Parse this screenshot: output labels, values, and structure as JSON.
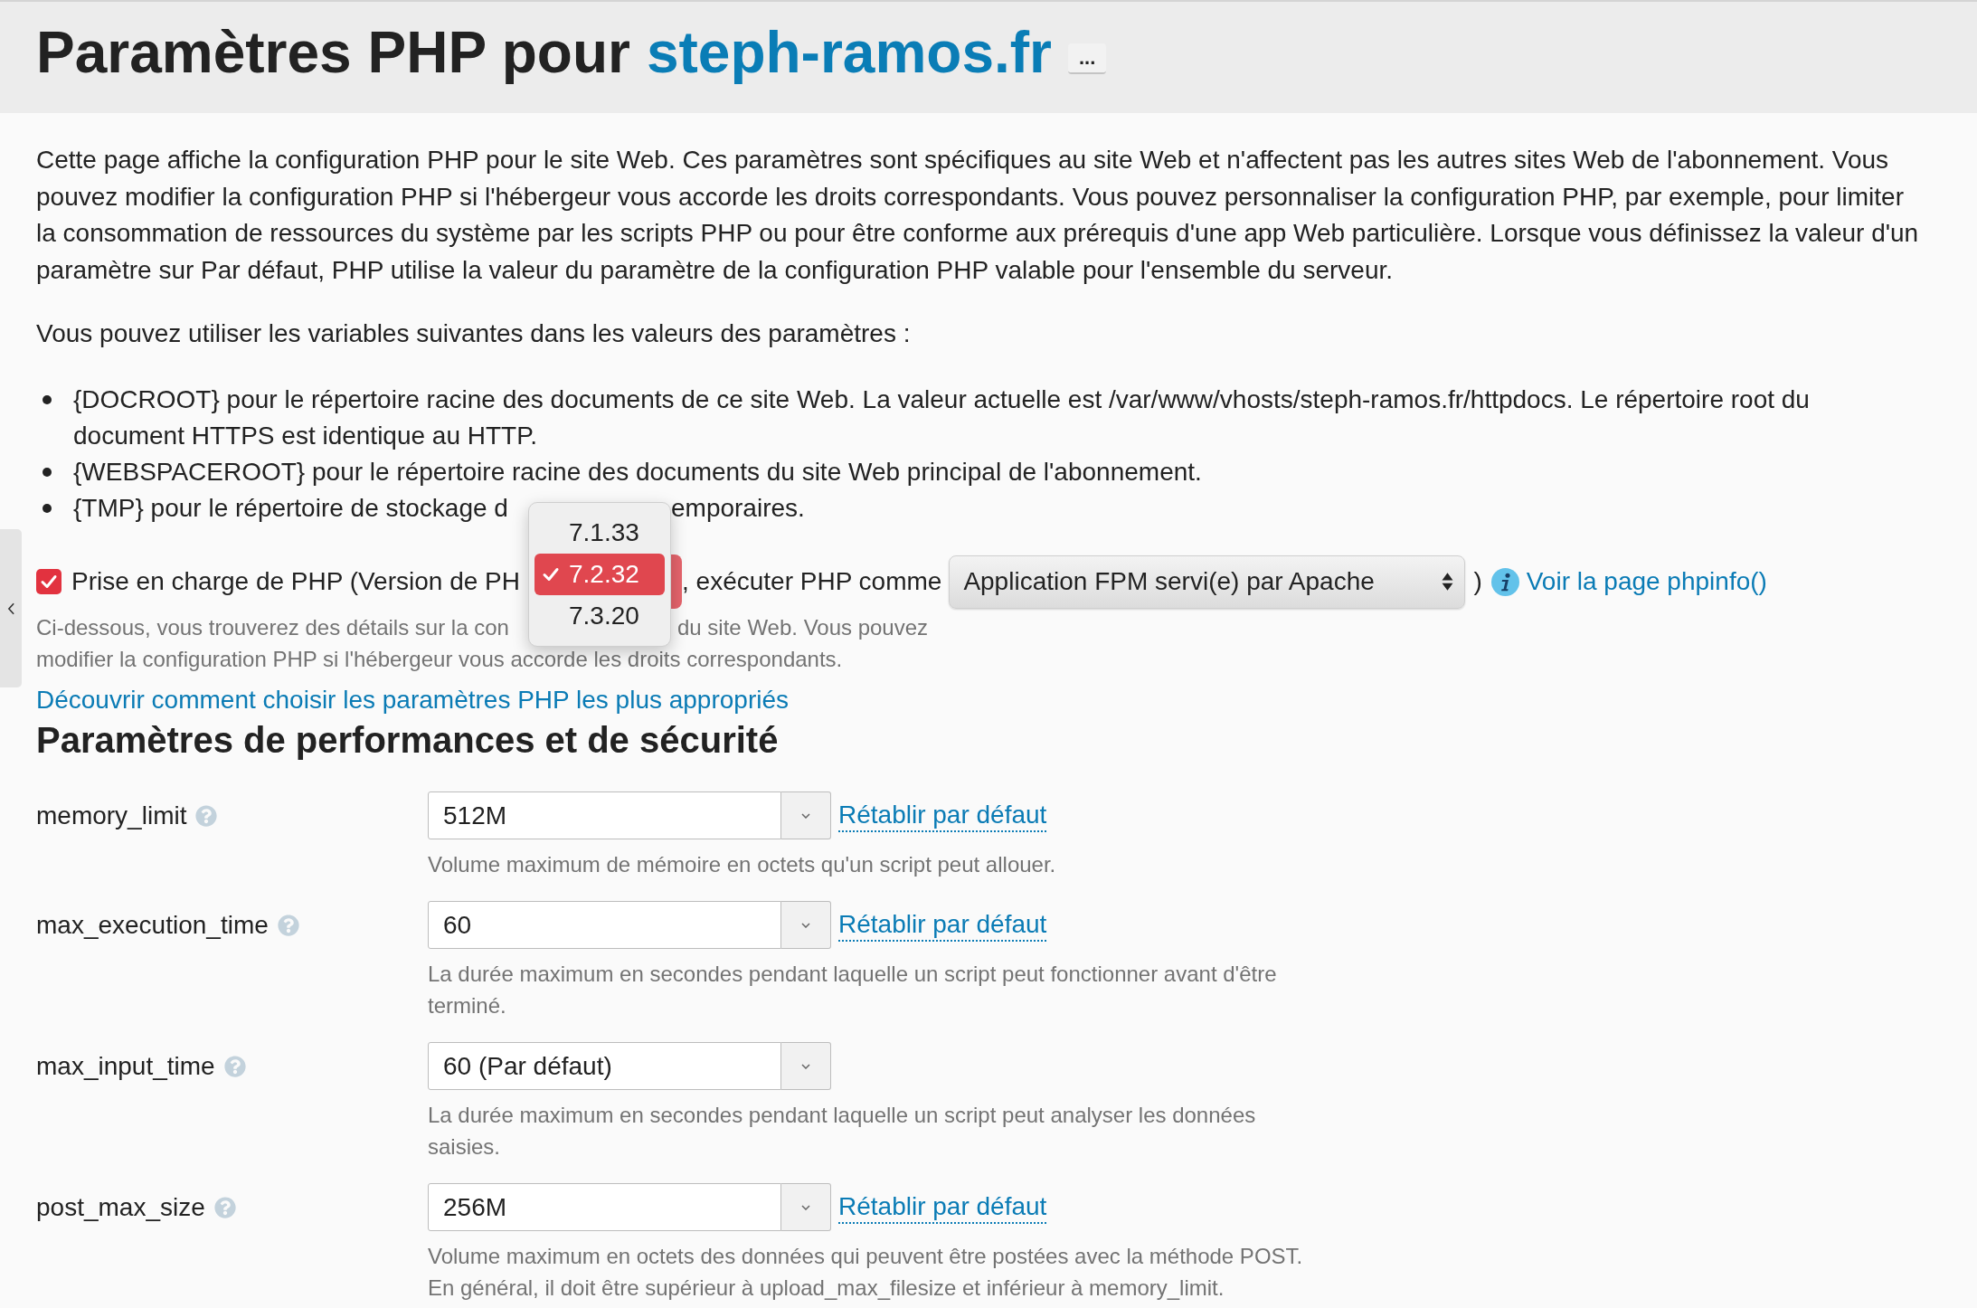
{
  "header": {
    "title": "Paramètres PHP pour",
    "domain": "steph-ramos.fr",
    "more_button": "..."
  },
  "intro": "Cette page affiche la configuration PHP pour le site Web. Ces paramètres sont spécifiques au site Web et n'affectent pas les autres sites Web de l'abonnement. Vous pouvez modifier la configuration PHP si l'hébergeur vous accorde les droits correspondants. Vous pouvez personnaliser la configuration PHP, par exemple, pour limiter la consommation de ressources du système par les scripts PHP ou pour être conforme aux prérequis d'une app Web particulière. Lorsque vous définissez la valeur d'un paramètre sur Par défaut, PHP utilise la valeur du paramètre de la configuration PHP valable pour l'ensemble du serveur.",
  "variables_intro": "Vous pouvez utiliser les variables suivantes dans les valeurs des paramètres :",
  "variables": [
    {
      "parts": [
        "{DOCROOT} pour le répertoire racine des documents de ce site Web. La valeur actuelle est /var/www/vhosts/steph-ramos.fr/httpdocs. Le répertoire root du document HTTPS est identique au HTTP."
      ]
    },
    {
      "parts": [
        "{WEBSPACEROOT} pour le répertoire racine des documents du site Web principal de l'abonnement."
      ]
    },
    {
      "parts": [
        "{TMP} pour le répertoire de stockage d",
        "emporaires."
      ]
    }
  ],
  "php_support": {
    "checked": true,
    "label": "Prise en charge de PHP (Version de PH",
    "version_select": {
      "open": true,
      "options": [
        {
          "label": "7.1.33",
          "selected": false
        },
        {
          "label": "7.2.32",
          "selected": true
        },
        {
          "label": "7.3.20",
          "selected": false
        }
      ]
    },
    "label_after": ", exécuter PHP comme",
    "handler_select": {
      "value": "Application FPM servi(e) par Apache"
    },
    "closing_paren": ")",
    "phpinfo_link": "Voir la page phpinfo()"
  },
  "support_hint": {
    "lines": [
      {
        "parts": [
          "Ci-dessous, vous trouverez des détails sur la con",
          "du site Web. Vous pouvez"
        ]
      },
      {
        "parts": [
          "modifier la configuration PHP si l'hébergeur vous accorde les droits correspondants."
        ]
      }
    ]
  },
  "guide_link": "Découvrir comment choisir les paramètres PHP les plus appropriés",
  "section_title": "Paramètres de performances et de sécurité",
  "settings": [
    {
      "name": "memory_limit",
      "value": "512M",
      "reset_link": "Rétablir par défaut",
      "hint": "Volume maximum de mémoire en octets qu'un script peut allouer."
    },
    {
      "name": "max_execution_time",
      "value": "60",
      "reset_link": "Rétablir par défaut",
      "hint": "La durée maximum en secondes pendant laquelle un script peut fonctionner avant d'être terminé."
    },
    {
      "name": "max_input_time",
      "value": "60 (Par défaut)",
      "hint": "La durée maximum en secondes pendant laquelle un script peut analyser les données saisies."
    },
    {
      "name": "post_max_size",
      "value": "256M",
      "reset_link": "Rétablir par défaut",
      "hint": "Volume maximum en octets des données qui peuvent être postées avec la méthode POST. En général, il doit être supérieur à upload_max_filesize et inférieur à memory_limit."
    }
  ]
}
